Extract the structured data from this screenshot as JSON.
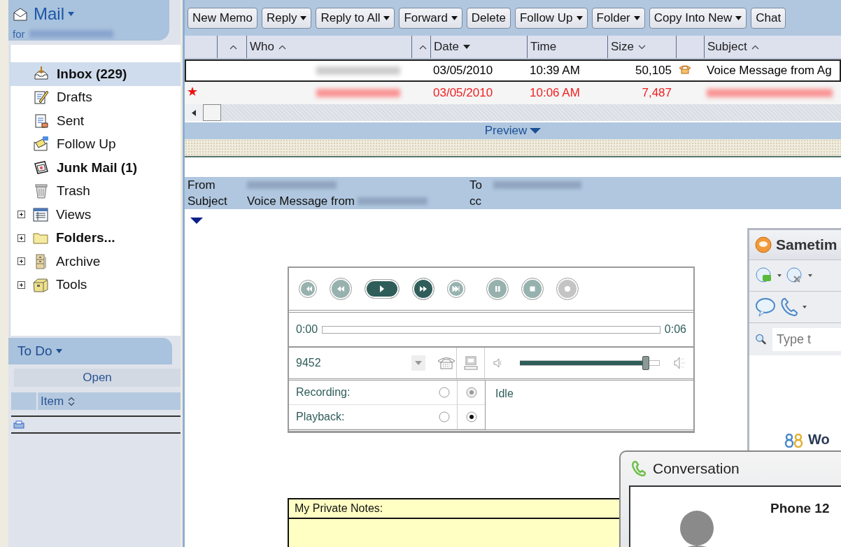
{
  "mail_header": {
    "title": "Mail",
    "for_label": "for"
  },
  "sidebar": {
    "items": [
      {
        "label": "Inbox (229)",
        "kind": "view",
        "emphasized": true,
        "selected": true
      },
      {
        "label": "Drafts",
        "kind": "view",
        "emphasized": false,
        "selected": false
      },
      {
        "label": "Sent",
        "kind": "view",
        "emphasized": false,
        "selected": false
      },
      {
        "label": "Follow Up",
        "kind": "view",
        "emphasized": false,
        "selected": false
      },
      {
        "label": "Junk Mail (1)",
        "kind": "view",
        "emphasized": true,
        "selected": false
      },
      {
        "label": "Trash",
        "kind": "view",
        "emphasized": false,
        "selected": false
      },
      {
        "label": "Views",
        "kind": "group",
        "expanded": false,
        "emphasized": false,
        "selected": false
      },
      {
        "label": "Folders...",
        "kind": "group",
        "expanded": false,
        "emphasized": true,
        "selected": false
      },
      {
        "label": "Archive",
        "kind": "group",
        "expanded": false,
        "emphasized": false,
        "selected": false
      },
      {
        "label": "Tools",
        "kind": "group",
        "expanded": false,
        "emphasized": false,
        "selected": false
      }
    ]
  },
  "todo": {
    "title": "To Do",
    "open_label": "Open",
    "column": "Item"
  },
  "toolbar": {
    "buttons": [
      {
        "label": "New Memo",
        "dropdown": false
      },
      {
        "label": "Reply",
        "dropdown": true
      },
      {
        "label": "Reply to All",
        "dropdown": true
      },
      {
        "label": "Forward",
        "dropdown": true
      },
      {
        "label": "Delete",
        "dropdown": false
      },
      {
        "label": "Follow Up",
        "dropdown": true
      },
      {
        "label": "Folder",
        "dropdown": true
      },
      {
        "label": "Copy Into New",
        "dropdown": true
      },
      {
        "label": "Chat",
        "dropdown": false
      }
    ]
  },
  "message_list": {
    "columns": [
      {},
      {
        "descending": false,
        "active": false
      },
      {
        "label": "Who",
        "descending": false,
        "active": false
      },
      {
        "descending": false,
        "active": false
      },
      {
        "label": "Date",
        "descending": true,
        "active": true
      },
      {
        "label": "Time"
      },
      {
        "label": "Size",
        "descending": true,
        "active": false
      },
      {},
      {
        "label": "Subject",
        "descending": false,
        "active": false
      }
    ],
    "rows": [
      {
        "date": "03/05/2010",
        "time": "10:39 AM",
        "size": "50,105",
        "kind": "voice",
        "subject": "Voice Message from Ag",
        "starred": false,
        "urgent": false,
        "selected": true
      },
      {
        "date": "03/05/2010",
        "time": "10:06 AM",
        "size": "7,487",
        "kind": "memo",
        "subject": "",
        "starred": true,
        "urgent": true,
        "selected": false
      }
    ]
  },
  "preview_bar": {
    "label": "Preview"
  },
  "message_header": {
    "from_label": "From",
    "to_label": "To",
    "subject_label": "Subject",
    "subject": "Voice Message from",
    "cc_label": "cc"
  },
  "player": {
    "controls": [
      {
        "disabled": true
      },
      {
        "disabled": true
      },
      {
        "disabled": false
      },
      {
        "disabled": false
      },
      {
        "disabled": true
      },
      {
        "disabled": true
      },
      {
        "disabled": true
      },
      {
        "disabled": true
      }
    ],
    "position": "0:00",
    "duration": "0:06",
    "progress": {
      "level": 0
    },
    "extension": "9452",
    "volume": {
      "level": 0.9
    },
    "modes": [
      {
        "label": "Recording:",
        "options": [
          {
            "selected": false,
            "disabled": false
          },
          {
            "selected": true,
            "disabled": true
          }
        ]
      },
      {
        "label": "Playback:",
        "options": [
          {
            "selected": false,
            "disabled": false
          },
          {
            "selected": true,
            "disabled": false
          }
        ]
      }
    ],
    "status": "Idle"
  },
  "notes": {
    "label": "My Private Notes:"
  },
  "sametime": {
    "title": "Sametim",
    "search_placeholder": "Type t",
    "group": "Wo"
  },
  "conversation": {
    "title": "Conversation",
    "name": "Phone 12"
  }
}
